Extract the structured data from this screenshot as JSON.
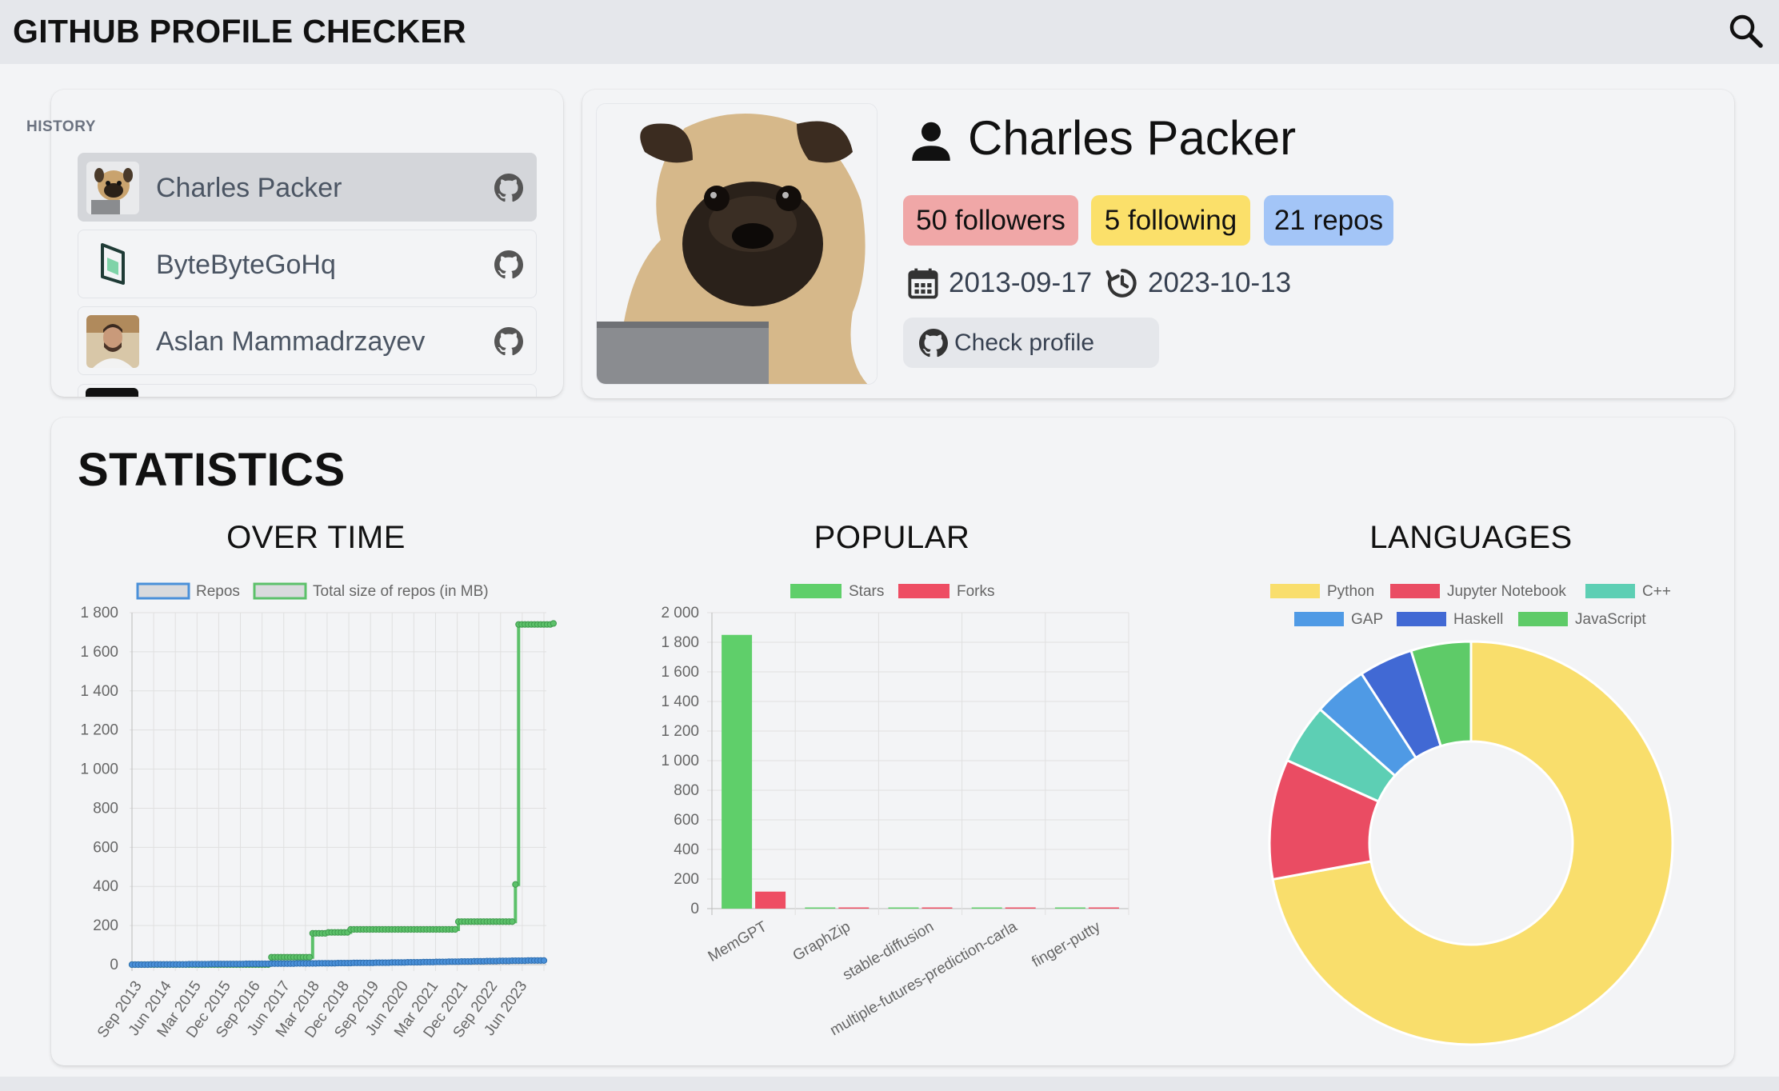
{
  "app": {
    "title": "GITHUB PROFILE CHECKER",
    "search_icon": "search-icon"
  },
  "history": {
    "label": "HISTORY",
    "items": [
      {
        "name": "Charles Packer",
        "avatar": "pug-photo",
        "active": true,
        "link_icon": "github-icon"
      },
      {
        "name": "ByteByteGoHq",
        "avatar": "bytebytego-logo",
        "active": false,
        "link_icon": "github-icon"
      },
      {
        "name": "Aslan Mammadrzayev",
        "avatar": "person-photo",
        "active": false,
        "link_icon": "github-icon"
      }
    ]
  },
  "profile": {
    "name": "Charles Packer",
    "followers": "50 followers",
    "following": "5 following",
    "repos": "21 repos",
    "created": "2013-09-17",
    "updated": "2023-10-13",
    "check_button": "Check profile",
    "colors": {
      "followers": "#f0a7a7",
      "following": "#fbe06a",
      "repos": "#a3c5f7"
    }
  },
  "statistics": {
    "title": "STATISTICS",
    "over_time_title": "OVER TIME",
    "popular_title": "POPULAR",
    "languages_title": "LANGUAGES"
  },
  "chart_data": [
    {
      "type": "line",
      "stepped": true,
      "series": [
        {
          "name": "Repos",
          "color": "#4a90d9",
          "values": [
            0,
            0,
            0,
            0,
            0,
            0,
            1,
            1,
            1,
            1,
            1,
            1,
            1,
            1,
            1,
            1,
            1,
            1,
            2,
            2,
            2,
            2,
            2,
            2,
            2,
            3,
            3,
            3,
            3,
            3,
            3,
            3,
            3,
            3,
            3,
            3,
            4,
            4,
            4,
            4,
            4,
            4,
            4,
            4,
            5,
            5,
            5,
            5,
            5,
            5,
            5,
            5,
            6,
            6,
            6,
            6,
            6,
            6,
            6,
            7,
            7,
            7,
            7,
            7,
            7,
            8,
            8,
            8,
            8,
            8,
            9,
            9,
            9,
            9,
            9,
            9,
            9,
            10,
            10,
            10,
            10,
            10,
            11,
            11,
            11,
            11,
            11,
            12,
            12,
            12,
            12,
            12,
            13,
            13,
            13,
            13,
            14,
            14,
            14,
            14,
            15,
            15,
            15,
            15,
            16,
            16,
            16,
            16,
            17,
            17,
            17,
            17,
            18,
            18,
            18,
            18,
            19,
            19,
            19,
            19,
            20,
            20,
            20,
            20,
            20,
            21,
            21,
            21,
            21,
            21,
            21
          ]
        },
        {
          "name": "Total size of repos (in MB)",
          "color": "#5cc16a",
          "values": [
            0,
            0,
            0,
            0,
            0,
            0,
            0,
            0,
            0,
            0,
            0,
            0,
            0,
            0,
            0,
            0,
            0,
            0,
            0,
            0,
            0,
            0,
            0,
            0,
            0,
            0,
            0,
            0,
            0,
            0,
            0,
            0,
            0,
            0,
            0,
            0,
            0,
            0,
            0,
            0,
            0,
            0,
            0,
            0,
            38,
            38,
            38,
            38,
            38,
            38,
            38,
            38,
            38,
            38,
            38,
            38,
            38,
            160,
            160,
            160,
            160,
            160,
            165,
            165,
            165,
            165,
            165,
            165,
            165,
            180,
            180,
            180,
            180,
            180,
            180,
            180,
            180,
            180,
            180,
            180,
            180,
            180,
            180,
            180,
            180,
            180,
            180,
            180,
            180,
            180,
            180,
            180,
            180,
            180,
            180,
            180,
            180,
            180,
            180,
            180,
            180,
            180,
            180,
            220,
            220,
            220,
            220,
            220,
            220,
            220,
            220,
            220,
            220,
            220,
            220,
            220,
            220,
            220,
            220,
            220,
            220,
            410,
            1740,
            1740,
            1740,
            1740,
            1740,
            1740,
            1740,
            1740,
            1740,
            1740,
            1740,
            1745
          ]
        }
      ],
      "x_tick_labels": [
        "Sep 2013",
        "Jun 2014",
        "Mar 2015",
        "Dec 2015",
        "Sep 2016",
        "Jun 2017",
        "Mar 2018",
        "Dec 2018",
        "Sep 2019",
        "Jun 2020",
        "Mar 2021",
        "Dec 2021",
        "Sep 2022",
        "Jun 2023"
      ],
      "y_tick_labels": [
        "0",
        "200",
        "400",
        "600",
        "800",
        "1 000",
        "1 200",
        "1 400",
        "1 600",
        "1 800"
      ],
      "ylim": [
        0,
        1800
      ],
      "legend": "top",
      "grid": true
    },
    {
      "type": "bar",
      "categories": [
        "MemGPT",
        "GraphZip",
        "stable-diffusion",
        "multiple-futures-prediction-carla",
        "finger-putty"
      ],
      "series": [
        {
          "name": "Stars",
          "color": "#5fcf6a",
          "values": [
            1850,
            5,
            3,
            8,
            3
          ]
        },
        {
          "name": "Forks",
          "color": "#ee4d63",
          "values": [
            115,
            1,
            0,
            2,
            1
          ]
        }
      ],
      "y_tick_labels": [
        "0",
        "200",
        "400",
        "600",
        "800",
        "1 000",
        "1 200",
        "1 400",
        "1 600",
        "1 800",
        "2 000"
      ],
      "ylim": [
        0,
        2000
      ],
      "legend": "top",
      "grid": true
    },
    {
      "type": "pie",
      "donut": true,
      "labels": [
        "Python",
        "Jupyter Notebook",
        "C++",
        "GAP",
        "Haskell",
        "JavaScript"
      ],
      "values": [
        75,
        10,
        5,
        4.5,
        4.5,
        5
      ],
      "colors": [
        "#f9de6c",
        "#ea4c63",
        "#5dcfb4",
        "#4f9ae5",
        "#4169d4",
        "#5ecb68"
      ],
      "legend": "top"
    }
  ]
}
